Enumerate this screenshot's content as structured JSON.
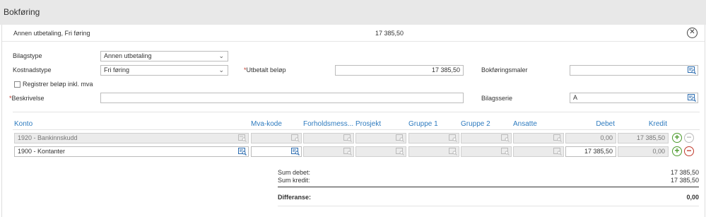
{
  "window": {
    "title": "Bokføring"
  },
  "header": {
    "title": "Annen utbetaling, Fri føring",
    "amount": "17 385,50",
    "close_icon": "close-circle-icon"
  },
  "form": {
    "bilagstype": {
      "label": "Bilagstype",
      "value": "Annen utbetaling"
    },
    "kostnadstype": {
      "label": "Kostnadstype",
      "value": "Fri føring"
    },
    "register_mva": {
      "label": "Registrer beløp inkl. mva",
      "checked": false
    },
    "beskrivelse": {
      "label": "Beskrivelse",
      "required_mark": "*",
      "value": ""
    },
    "utbetalt_belop": {
      "label": "Utbetalt beløp",
      "required_mark": "*",
      "value": "17 385,50"
    },
    "bokforingsmaler": {
      "label": "Bokføringsmaler",
      "value": ""
    },
    "bilagsserie": {
      "label": "Bilagsserie",
      "value": "A"
    }
  },
  "table": {
    "columns": {
      "konto": "Konto",
      "mva": "Mva-kode",
      "forhold": "Forholdsmess...",
      "prosjekt": "Prosjekt",
      "gruppe1": "Gruppe 1",
      "gruppe2": "Gruppe 2",
      "ansatte": "Ansatte",
      "debet": "Debet",
      "kredit": "Kredit"
    },
    "rows": [
      {
        "konto": "1920 - Bankinnskudd",
        "mva": "",
        "debet": "0,00",
        "kredit": "17 385,50",
        "editable": false
      },
      {
        "konto": "1900 - Kontanter",
        "mva": "",
        "debet": "17 385,50",
        "kredit": "0,00",
        "editable": true
      }
    ]
  },
  "summary": {
    "sum_debet_label": "Sum debet:",
    "sum_debet": "17 385,50",
    "sum_kredit_label": "Sum kredit:",
    "sum_kredit": "17 385,50",
    "differanse_label": "Differanse:",
    "differanse": "0,00"
  },
  "colors": {
    "link_blue": "#2e7bbf",
    "add_green": "#4a9a2a",
    "remove_red": "#c0392b",
    "lookup_blue": "#2b6cb0"
  }
}
